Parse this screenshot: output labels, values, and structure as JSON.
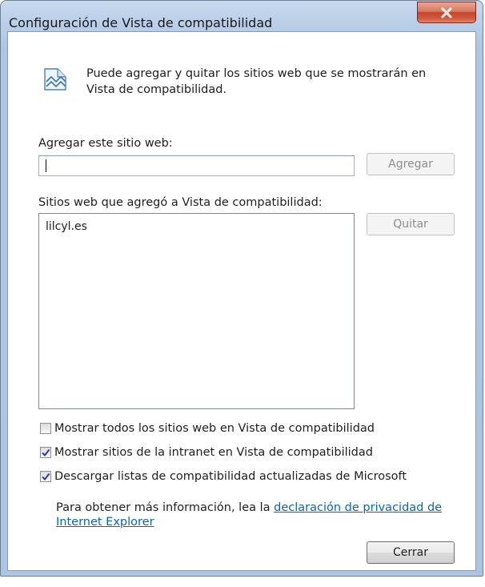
{
  "window": {
    "title": "Configuración de Vista de compatibilidad"
  },
  "info": {
    "text": "Puede agregar y quitar los sitios web que se mostrarán en Vista de compatibilidad.",
    "icon": "compat-view-icon"
  },
  "add_site": {
    "label": "Agregar este sitio web:",
    "value": "",
    "placeholder": "",
    "button_label": "Agregar"
  },
  "sites": {
    "label": "Sitios web que agregó a Vista de compatibilidad:",
    "items": [
      "lilcyl.es"
    ],
    "remove_label": "Quitar"
  },
  "options": [
    {
      "label": "Mostrar todos los sitios web en Vista de compatibilidad",
      "checked": false
    },
    {
      "label": "Mostrar sitios de la intranet en Vista de compatibilidad",
      "checked": true
    },
    {
      "label": "Descargar listas de compatibilidad actualizadas de Microsoft",
      "checked": true
    }
  ],
  "more_info": {
    "prefix": "Para obtener más información, lea la ",
    "link_text": "declaración de privacidad de Internet Explorer"
  },
  "footer": {
    "close_label": "Cerrar"
  },
  "colors": {
    "link": "#0066cc",
    "close_button": "#c7452b"
  }
}
